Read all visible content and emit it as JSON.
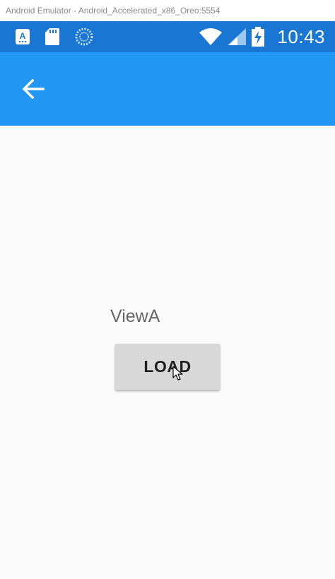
{
  "window": {
    "title": "Android Emulator - Android_Accelerated_x86_Oreo:5554"
  },
  "status_bar": {
    "left_icons": [
      "text-app-notification-icon",
      "sd-card-icon",
      "loading-spinner-icon"
    ],
    "right_icons": [
      "wifi-icon",
      "cellular-signal-icon",
      "battery-charging-icon"
    ],
    "time": "10:43",
    "background": "#1976D2"
  },
  "app_bar": {
    "background": "#2196F3",
    "back_icon": "arrow-back-icon"
  },
  "content": {
    "label": "ViewA",
    "load_button_label": "LOAD",
    "background": "#fafafa"
  }
}
